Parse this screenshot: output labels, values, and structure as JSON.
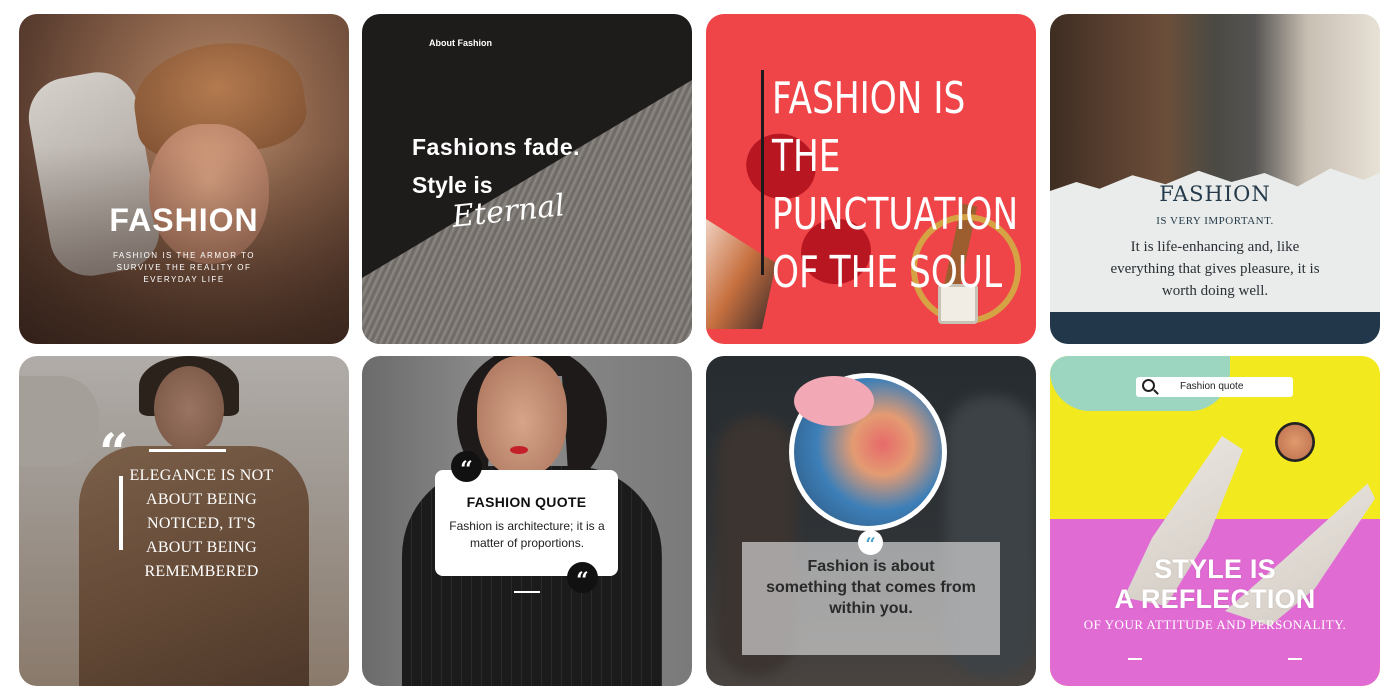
{
  "cards": [
    {
      "title": "FASHION",
      "subtitle": "FASHION IS THE ARMOR TO SURVIVE THE REALITY OF EVERYDAY LIFE"
    },
    {
      "label": "About Fashion",
      "line1": "Fashions fade.",
      "line2": "Style is",
      "script": "Eternal"
    },
    {
      "lines": [
        "FASHION IS",
        "THE",
        "PUNCTUATION",
        "OF THE SOUL"
      ]
    },
    {
      "title": "FASHION",
      "subtitle": "IS VERY IMPORTANT.",
      "body": "It is life-enhancing and, like everything that gives pleasure, it is worth doing well."
    },
    {
      "quote_mark": "“",
      "text": "ELEGANCE IS NOT ABOUT BEING NOTICED, IT'S ABOUT BEING REMEMBERED"
    },
    {
      "quote_mark": "“",
      "title": "FASHION QUOTE",
      "body": "Fashion is architecture; it is a matter of proportions.",
      "quote_mark_end": "“"
    },
    {
      "quote_mark": "“",
      "text": "Fashion is about something that comes from within you."
    },
    {
      "search_text": "Fashion quote",
      "title_line1": "STYLE IS",
      "title_line2": "A REFLECTION",
      "subtitle": "OF YOUR ATTITUDE AND PERSONALITY."
    }
  ]
}
